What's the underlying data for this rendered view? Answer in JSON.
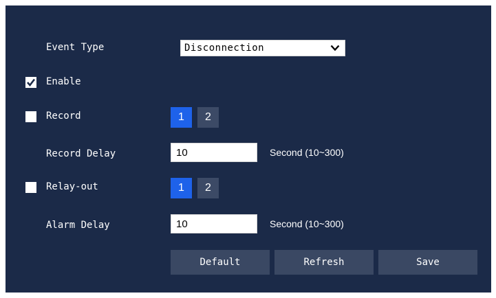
{
  "form": {
    "event_type_label": "Event Type",
    "event_type_value": "Disconnection",
    "enable_label": "Enable",
    "enable_checked": true,
    "record_label": "Record",
    "record_checked": false,
    "record_channels": [
      "1",
      "2"
    ],
    "record_active_channel": "1",
    "record_delay_label": "Record Delay",
    "record_delay_value": "10",
    "record_delay_unit": "Second (10~300)",
    "relay_out_label": "Relay-out",
    "relay_out_checked": false,
    "relay_channels": [
      "1",
      "2"
    ],
    "relay_active_channel": "1",
    "alarm_delay_label": "Alarm Delay",
    "alarm_delay_value": "10",
    "alarm_delay_unit": "Second (10~300)"
  },
  "buttons": {
    "default_label": "Default",
    "refresh_label": "Refresh",
    "save_label": "Save"
  },
  "icons": {
    "checkmark": "check-icon",
    "dropdown": "chevron-down-icon"
  },
  "colors": {
    "panel_bg": "#1b2a48",
    "active_channel": "#1e62ea",
    "inactive_channel": "#3c4a66",
    "button_bg": "#3a4863"
  }
}
